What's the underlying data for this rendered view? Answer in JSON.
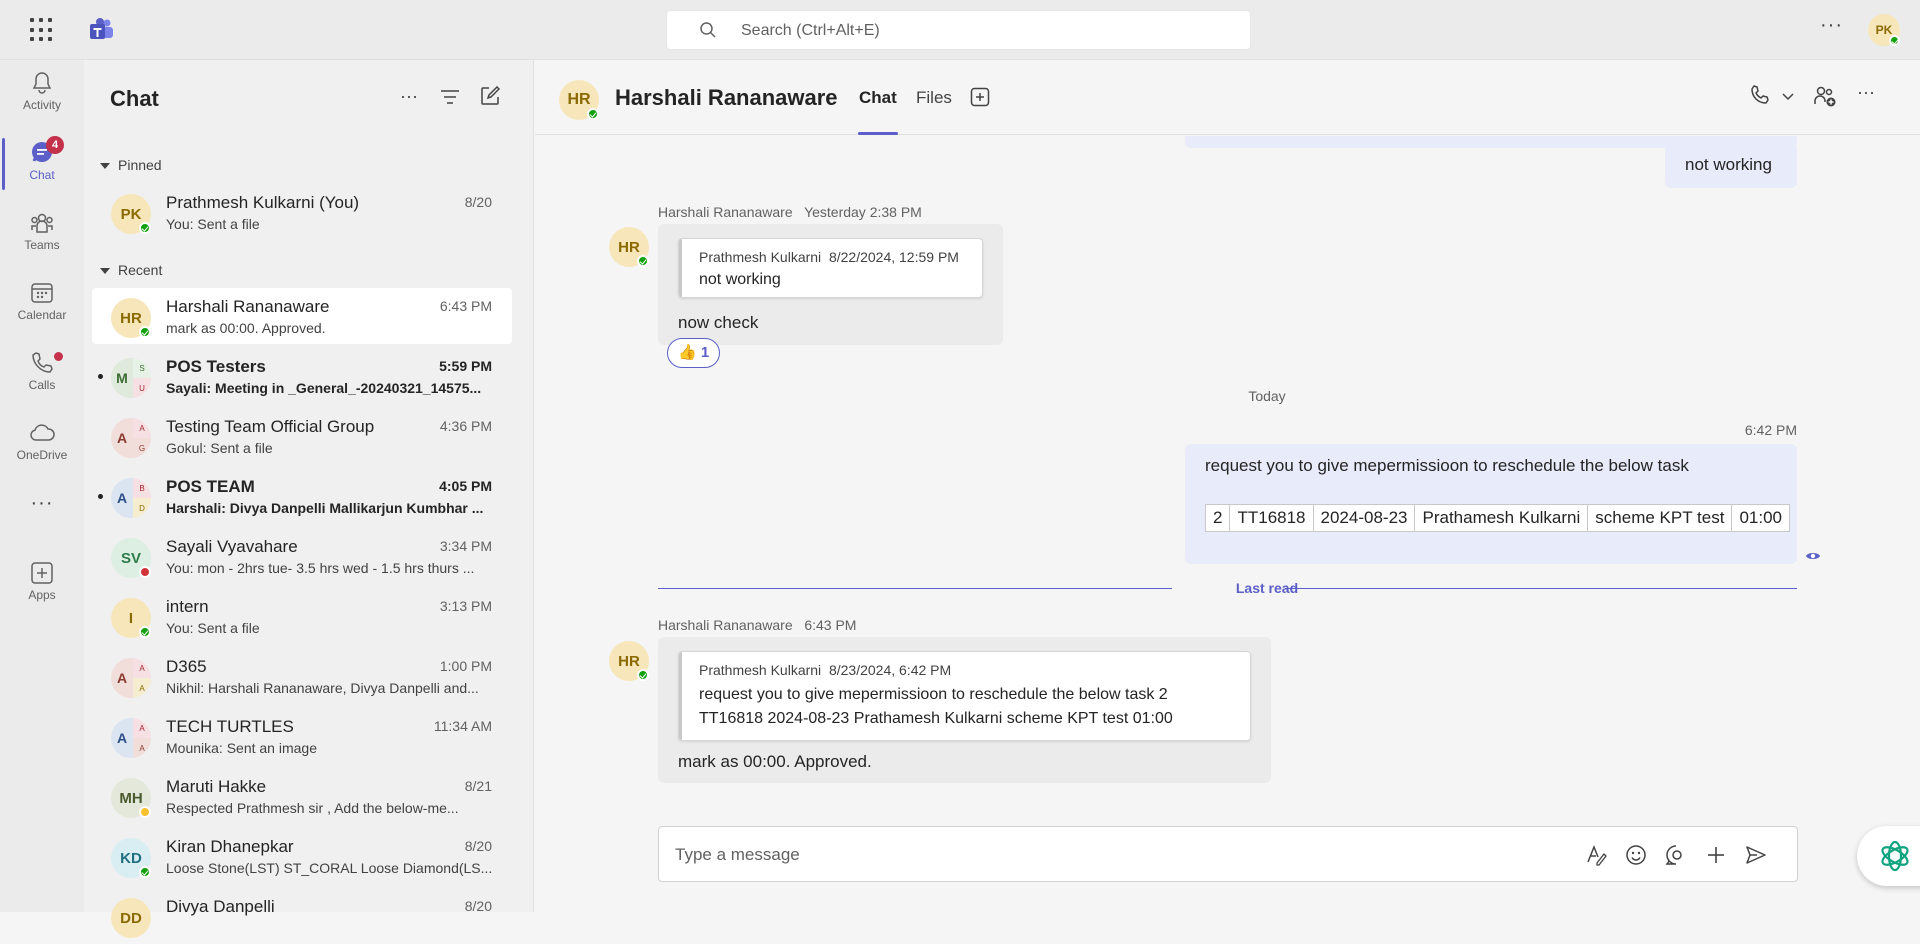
{
  "app": {
    "search_placeholder": "Search (Ctrl+Alt+E)",
    "me_initials": "PK"
  },
  "rail": {
    "activity": "Activity",
    "chat": "Chat",
    "chat_badge": "4",
    "teams": "Teams",
    "calendar": "Calendar",
    "calls": "Calls",
    "onedrive": "OneDrive",
    "apps": "Apps"
  },
  "list": {
    "title": "Chat",
    "pinned_label": "Pinned",
    "recent_label": "Recent",
    "pinned": [
      {
        "initials": "PK",
        "name": "Prathmesh Kulkarni (You)",
        "time": "8/20",
        "preview": "You: Sent a file"
      }
    ],
    "recent": [
      {
        "initials": "HR",
        "name": "Harshali Rananaware",
        "time": "6:43 PM",
        "preview": "mark as 00:00. Approved."
      },
      {
        "initials": "M",
        "sub1": "S",
        "sub2": "U",
        "name": "POS Testers",
        "time": "5:59 PM",
        "preview": "Sayali: Meeting in _General_-20240321_14575..."
      },
      {
        "initials": "A",
        "sub1": "A",
        "sub2": "G",
        "name": "Testing Team Official Group",
        "time": "4:36 PM",
        "preview": "Gokul: Sent a file"
      },
      {
        "initials": "A",
        "sub1": "B",
        "sub2": "D",
        "name": "POS TEAM",
        "time": "4:05 PM",
        "preview": "Harshali: Divya Danpelli Mallikarjun Kumbhar ..."
      },
      {
        "initials": "SV",
        "name": "Sayali Vyavahare",
        "time": "3:34 PM",
        "preview": "You: mon - 2hrs tue- 3.5 hrs wed - 1.5 hrs thurs ..."
      },
      {
        "initials": "I",
        "name": "intern",
        "time": "3:13 PM",
        "preview": "You: Sent a file"
      },
      {
        "initials": "A",
        "sub1": "A",
        "sub2": "A",
        "name": "D365",
        "time": "1:00 PM",
        "preview": "Nikhil: Harshali Rananaware, Divya Danpelli and..."
      },
      {
        "initials": "A",
        "sub1": "A",
        "sub2": "A",
        "name": "TECH TURTLES",
        "time": "11:34 AM",
        "preview": "Mounika: Sent an image"
      },
      {
        "initials": "MH",
        "name": "Maruti Hakke",
        "time": "8/21",
        "preview": "Respected  Prathmesh sir ,   Add the below-me..."
      },
      {
        "initials": "KD",
        "name": "Kiran Dhanepkar",
        "time": "8/20",
        "preview": "Loose Stone(LST) ST_CORAL Loose Diamond(LS..."
      },
      {
        "initials": "DD",
        "name": "Divya Danpelli",
        "time": "8/20",
        "preview": ""
      }
    ]
  },
  "conversation": {
    "initials": "HR",
    "name": "Harshali Rananaware",
    "tab_chat": "Chat",
    "tab_files": "Files",
    "msg0_text": "not working",
    "msg1": {
      "sender": "Harshali Rananaware",
      "time": "Yesterday 2:38 PM",
      "quote_author": "Prathmesh Kulkarni",
      "quote_time": "8/22/2024, 12:59 PM",
      "quote_text": "not working",
      "text": "now check",
      "reaction_emoji": "👍",
      "reaction_count": "1"
    },
    "day_divider": "Today",
    "msg2": {
      "time": "6:42 PM",
      "text": "request you to give mepermissioon to reschedule the below task",
      "table": [
        "2",
        "TT16818",
        "2024-08-23",
        "Prathamesh Kulkarni",
        "scheme KPT test",
        "01:00"
      ]
    },
    "last_read": "Last read",
    "msg3": {
      "sender": "Harshali Rananaware",
      "time": "6:43 PM",
      "quote_author": "Prathmesh Kulkarni",
      "quote_time": "8/23/2024, 6:42 PM",
      "quote_line1": "request you to give mepermissioon to reschedule the below task 2",
      "quote_line2": "TT16818 2024-08-23 Prathamesh Kulkarni scheme KPT test 01:00",
      "text": "mark as 00:00. Approved."
    },
    "composer_placeholder": "Type a message"
  }
}
